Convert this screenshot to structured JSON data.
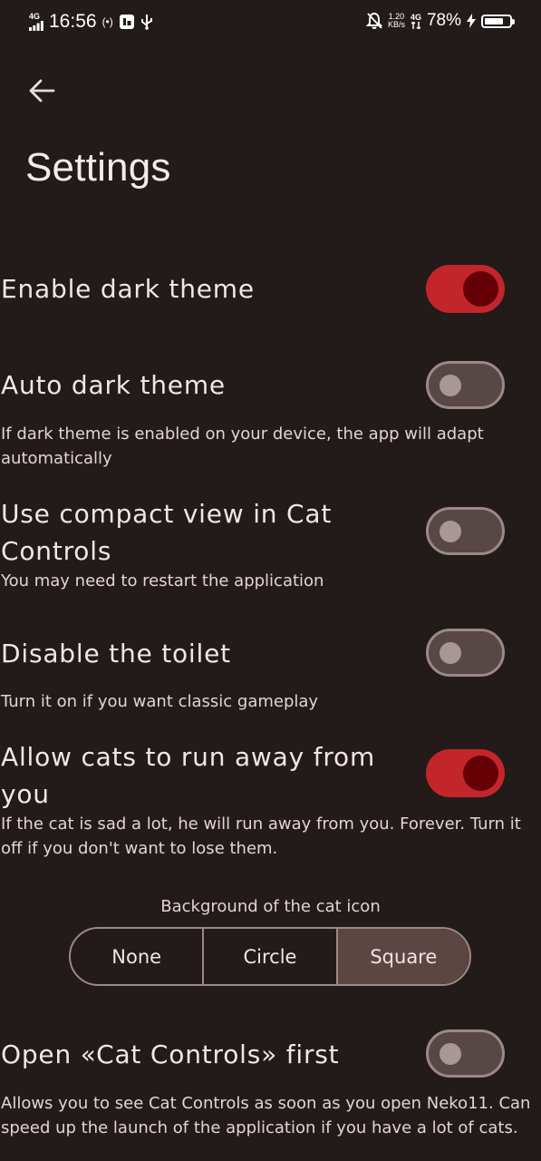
{
  "status_bar": {
    "network": "4G",
    "time": "16:56",
    "hotspot": "(•)",
    "rate_value": "1.20",
    "rate_unit": "KB/s",
    "network2": "4G",
    "battery": "78%",
    "battery_level": 0.78
  },
  "header": {
    "back_icon": "arrow-left-icon",
    "title": "Settings"
  },
  "settings": [
    {
      "title": "Enable dark theme",
      "description": "",
      "enabled": true
    },
    {
      "title": "Auto dark theme",
      "description": "If dark theme is enabled on your device, the app will adapt automatically",
      "enabled": false
    },
    {
      "title": "Use compact view in Cat Controls",
      "description": "You may need to restart the application",
      "enabled": false
    },
    {
      "title": "Disable the toilet",
      "description": "Turn it on if you want classic gameplay",
      "enabled": false
    },
    {
      "title": "Allow cats to run away from you",
      "description": "If the cat is sad a lot, he will run away from you. Forever. Turn it off if you don't want to lose them.",
      "enabled": true
    },
    {
      "title": "Open «Cat Controls» first",
      "description": "Allows you to see Cat Controls as soon as you open Neko11. Can speed up the launch of the application if you have a lot of cats.",
      "enabled": false
    }
  ],
  "cat_icon_background": {
    "label": "Background of the cat icon",
    "options": [
      "None",
      "Circle",
      "Square"
    ],
    "selected": "Square"
  },
  "colors": {
    "background": "#221b1a",
    "switch_on_track": "#c2262b",
    "switch_on_knob": "#660007",
    "switch_off_track": "#574745",
    "selected_segment": "#5c4643"
  }
}
